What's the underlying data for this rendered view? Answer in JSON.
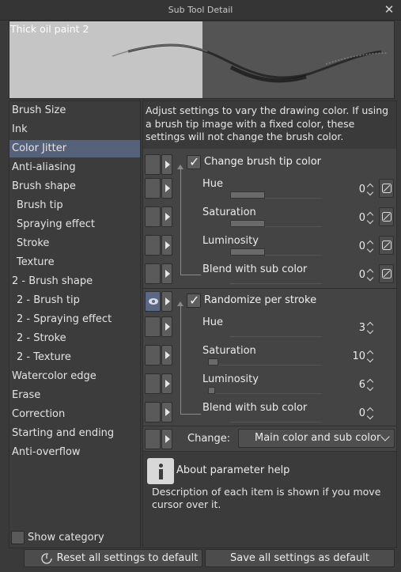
{
  "window": {
    "title": "Sub Tool Detail",
    "close_label": "✕"
  },
  "preview": {
    "name": "Thick oil paint 2"
  },
  "sidebar": {
    "items": [
      {
        "label": "Brush Size",
        "level": "top",
        "selected": false
      },
      {
        "label": "Ink",
        "level": "top",
        "selected": false
      },
      {
        "label": "Color Jitter",
        "level": "top",
        "selected": true
      },
      {
        "label": "Anti-aliasing",
        "level": "top",
        "selected": false
      },
      {
        "label": "Brush shape",
        "level": "top",
        "selected": false
      },
      {
        "label": "Brush tip",
        "level": "sub",
        "selected": false
      },
      {
        "label": "Spraying effect",
        "level": "sub",
        "selected": false
      },
      {
        "label": "Stroke",
        "level": "sub",
        "selected": false
      },
      {
        "label": "Texture",
        "level": "sub",
        "selected": false
      },
      {
        "label": "2 - Brush shape",
        "level": "top",
        "selected": false
      },
      {
        "label": "2 - Brush tip",
        "level": "sub",
        "selected": false
      },
      {
        "label": "2 - Spraying effect",
        "level": "sub",
        "selected": false
      },
      {
        "label": "2 - Stroke",
        "level": "sub",
        "selected": false
      },
      {
        "label": "2 - Texture",
        "level": "sub",
        "selected": false
      },
      {
        "label": "Watercolor edge",
        "level": "top",
        "selected": false
      },
      {
        "label": "Erase",
        "level": "top",
        "selected": false
      },
      {
        "label": "Correction",
        "level": "top",
        "selected": false
      },
      {
        "label": "Starting and ending",
        "level": "top",
        "selected": false
      },
      {
        "label": "Anti-overflow",
        "level": "top",
        "selected": false
      }
    ],
    "show_category_label": "Show category"
  },
  "main": {
    "description": "Adjust settings to vary the drawing color. If using a brush tip image with a fixed color, these settings will not change the brush color.",
    "group1": {
      "checkbox_label": "Change brush tip color",
      "checked": true,
      "params": [
        {
          "label": "Hue",
          "value": "0",
          "fill": 0.5
        },
        {
          "label": "Saturation",
          "value": "0",
          "fill": 0.5
        },
        {
          "label": "Luminosity",
          "value": "0",
          "fill": 0.5
        },
        {
          "label": "Blend with sub color",
          "value": "0",
          "fill": 0
        }
      ]
    },
    "group2": {
      "checkbox_label": "Randomize per stroke",
      "checked": true,
      "params": [
        {
          "label": "Hue",
          "value": "3",
          "fill": 0.0
        },
        {
          "label": "Saturation",
          "value": "10",
          "fill": 0.1
        },
        {
          "label": "Luminosity",
          "value": "6",
          "fill": 0.06
        },
        {
          "label": "Blend with sub color",
          "value": "0",
          "fill": 0
        }
      ]
    },
    "change": {
      "label": "Change:",
      "selected": "Main color and sub color"
    },
    "help": {
      "title": "About parameter help",
      "text": "Description of each item is shown if you move cursor over it."
    }
  },
  "footer": {
    "reset_label": "Reset all settings to default",
    "save_label": "Save all settings as default"
  },
  "colors": {
    "background": "#3a3a3a",
    "selected_item": "#56627a",
    "eye_active": "#5b6885"
  }
}
